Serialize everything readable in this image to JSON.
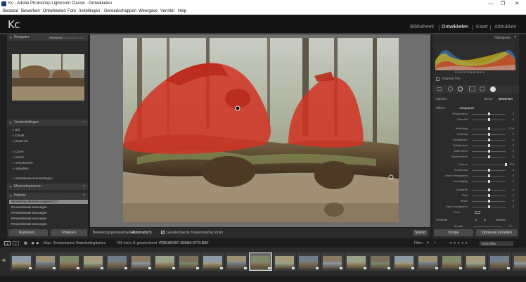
{
  "window": {
    "title": "Kc - Adobe Photoshop Lightroom Classic - Ontwikkelen",
    "minimize": "—",
    "maximize": "❐",
    "close": "✕"
  },
  "menu": [
    "Bestand",
    "Bewerken",
    "Ontwikkelen",
    "Foto",
    "Instellingen",
    "Gereedschappen",
    "Weergave",
    "Venster",
    "Help"
  ],
  "identity": {
    "logo": "Kc"
  },
  "modules": [
    "Bibliotheek",
    "Ontwikkelen",
    "Kaart",
    "Afdrukken"
  ],
  "active_module": "Ontwikkelen",
  "left": {
    "navigator": {
      "title": "Navigator",
      "opts": [
        "PASSEND",
        "VULLEN",
        "1:1",
        "1:3"
      ]
    },
    "presets": {
      "title": "Voorinstellingen",
      "items_a": [
        "Bril",
        "Cristal",
        "Zwart-wit"
      ],
      "items_b": [
        "Curve",
        "Korrel",
        "Verscherpen",
        "Vignetten"
      ],
      "user": "Gebruikersvoorinstellingen"
    },
    "snapshots": {
      "title": "Momentopnamen"
    },
    "history": {
      "title": "Historie",
      "items": [
        "Bewerking penseel toegepast (3)",
        "Penseelstreek toevoegen",
        "Penseelstreek toevoegen",
        "Penseelstreek toevoegen",
        "Penseelstreek toevoegen"
      ]
    },
    "copy_button": "Kopiëren...",
    "paste_button": "Plakken"
  },
  "toolbar": {
    "mask_label": "Bewerkingspenseelmasker: ",
    "mask_mode": "Automatisch",
    "show_overlay": "Geselecteerde maskeroverlay tonen"
  },
  "right": {
    "histogram_title": "Histogram",
    "histogram_readout": "R  42,2   G  39,6   B  39,4 %",
    "original_photo": "Originele foto",
    "tabs": [
      "Masker :",
      "Nieuw",
      "Bewerken"
    ],
    "effect_label": "Effect :",
    "custom_label": "Aangepast",
    "sliders": [
      {
        "label": "Temperatuur",
        "value": "0",
        "pos": 0.5
      },
      {
        "label": "Kleurtint",
        "value": "0",
        "pos": 0.5
      },
      {
        "label": "Belichting",
        "value": "0,00",
        "pos": 0.5
      },
      {
        "label": "Contrast",
        "value": "0",
        "pos": 0.5
      },
      {
        "label": "Hooglichten",
        "value": "0",
        "pos": 0.5
      },
      {
        "label": "Schaduwen",
        "value": "0",
        "pos": 0.5
      },
      {
        "label": "Witte tinten",
        "value": "0",
        "pos": 0.5
      },
      {
        "label": "Zwarte tinten",
        "value": "0",
        "pos": 0.5
      },
      {
        "label": "Textuur",
        "value": "100",
        "pos": 1.0
      },
      {
        "label": "Helderheid",
        "value": "0",
        "pos": 0.5
      },
      {
        "label": "Nevel verwijderen",
        "value": "0",
        "pos": 0.5
      },
      {
        "label": "Verzadiging",
        "value": "0",
        "pos": 0.5
      },
      {
        "label": "Scherpte",
        "value": "0",
        "pos": 0.5
      },
      {
        "label": "Ruis",
        "value": "0",
        "pos": 0.5
      },
      {
        "label": "Moiré",
        "value": "0",
        "pos": 0.5
      },
      {
        "label": "Rand verwijderen",
        "value": "0",
        "pos": 0.5
      }
    ],
    "color_label": "Kleur",
    "brush_label": "Penseel :",
    "brush_opts": [
      "A",
      "B",
      "Wissen"
    ],
    "size_label": "Grootte",
    "size_value": "7,0",
    "previous_button": "Vorige",
    "reset_button": "Opnieuw instellen",
    "close_button": "Sluiten"
  },
  "filmstrip_bar": {
    "pages": [
      "1",
      "2"
    ],
    "path": "Map : Amsterdamse Waterleidingduinen",
    "count": "555 foto's /1 geselecteerd",
    "filename": "/P2018O407-153454-0773.RAF",
    "filter_label": "Filter :",
    "filter_value": "Geen filter"
  },
  "filmstrip": {
    "selected_index": 10,
    "count": 22
  }
}
